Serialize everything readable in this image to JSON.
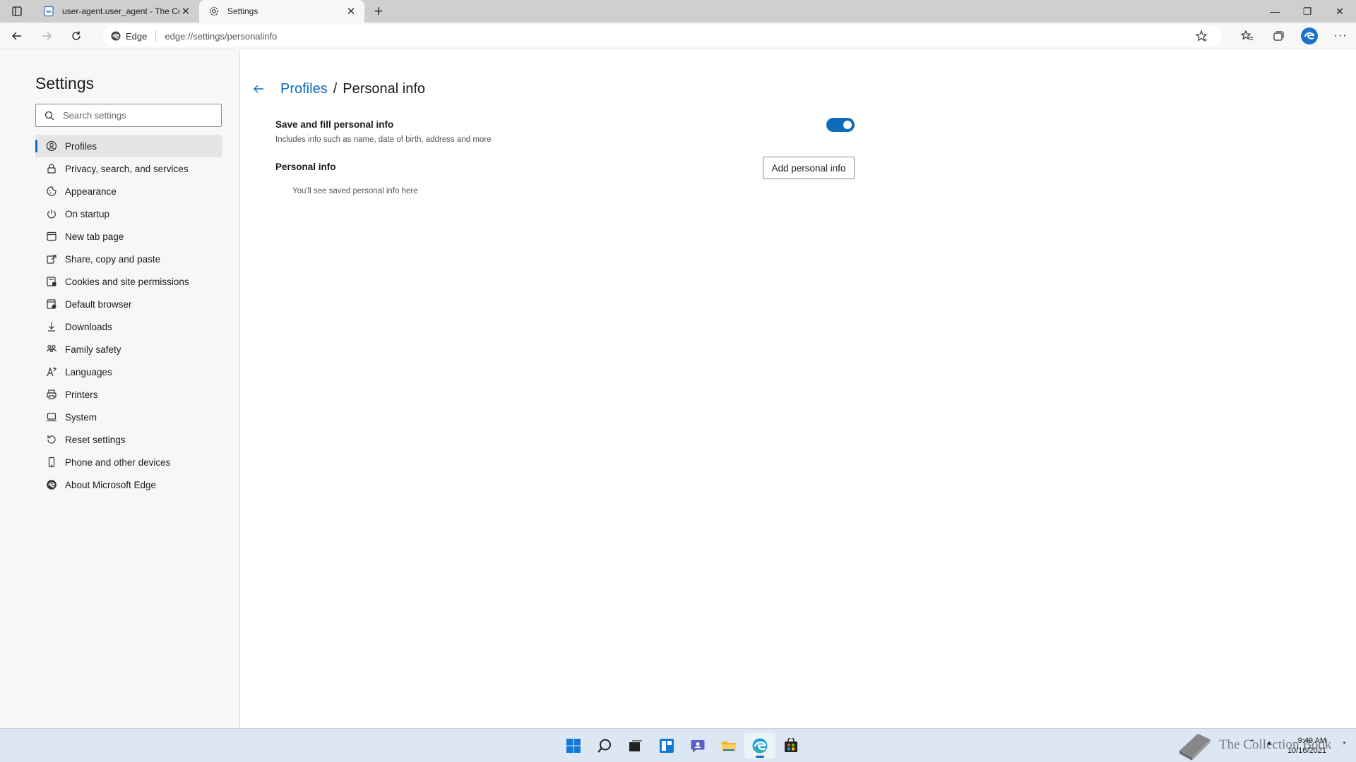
{
  "browser": {
    "tabs": [
      {
        "title": "user-agent.user_agent - The Coll",
        "active": false,
        "icon": "document-icon"
      },
      {
        "title": "Settings",
        "active": true,
        "icon": "gear-icon"
      }
    ],
    "site_label": "Edge",
    "url": "edge://settings/personalinfo"
  },
  "sidebar": {
    "title": "Settings",
    "search_placeholder": "Search settings",
    "items": [
      {
        "label": "Profiles",
        "icon": "profile-icon",
        "selected": true
      },
      {
        "label": "Privacy, search, and services",
        "icon": "lock-icon"
      },
      {
        "label": "Appearance",
        "icon": "appearance-icon"
      },
      {
        "label": "On startup",
        "icon": "power-icon"
      },
      {
        "label": "New tab page",
        "icon": "new-tab-icon"
      },
      {
        "label": "Share, copy and paste",
        "icon": "share-icon"
      },
      {
        "label": "Cookies and site permissions",
        "icon": "cookies-icon"
      },
      {
        "label": "Default browser",
        "icon": "default-browser-icon"
      },
      {
        "label": "Downloads",
        "icon": "download-icon"
      },
      {
        "label": "Family safety",
        "icon": "family-icon"
      },
      {
        "label": "Languages",
        "icon": "languages-icon"
      },
      {
        "label": "Printers",
        "icon": "printer-icon"
      },
      {
        "label": "System",
        "icon": "system-icon"
      },
      {
        "label": "Reset settings",
        "icon": "reset-icon"
      },
      {
        "label": "Phone and other devices",
        "icon": "phone-icon"
      },
      {
        "label": "About Microsoft Edge",
        "icon": "edge-icon"
      }
    ]
  },
  "main": {
    "breadcrumb_parent": "Profiles",
    "breadcrumb_separator": "/",
    "breadcrumb_current": "Personal info",
    "save_fill_title": "Save and fill personal info",
    "save_fill_desc": "Includes info such as name, date of birth, address and more",
    "save_fill_enabled": true,
    "personal_info_title": "Personal info",
    "add_button": "Add personal info",
    "empty_message": "You'll see saved personal info here"
  },
  "taskbar": {
    "time": "9:49 AM",
    "date": "10/16/2021",
    "watermark": "The Collection Book"
  },
  "colors": {
    "accent": "#0f6cbd",
    "sidebar_bg": "#f7f7f7",
    "tabstrip_bg": "#cfcfcf",
    "taskbar_bg": "#dde7f3"
  }
}
